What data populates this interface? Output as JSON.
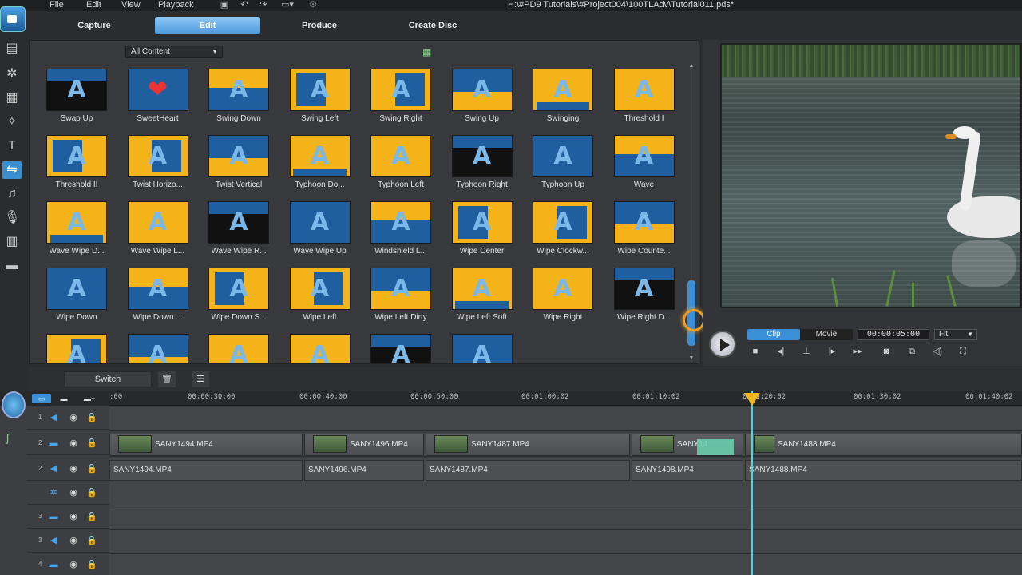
{
  "menu": [
    "File",
    "Edit",
    "View",
    "Playback"
  ],
  "file_path": "H:\\#PD9 Tutorials\\#Project004\\100TLAdv\\Tutorial011.pds*",
  "modes": [
    {
      "label": "Capture",
      "active": false
    },
    {
      "label": "Edit",
      "active": true
    },
    {
      "label": "Produce",
      "active": false
    },
    {
      "label": "Create Disc",
      "active": false
    }
  ],
  "library": {
    "filter_value": "All Content",
    "transitions": [
      [
        "Swap Up",
        "SweetHeart",
        "Swing Down",
        "Swing Left",
        "Swing Right",
        "Swing Up",
        "Swinging",
        "Threshold I"
      ],
      [
        "Threshold II",
        "Twist Horizo...",
        "Twist Vertical",
        "Typhoon Do...",
        "Typhoon Left",
        "Typhoon Right",
        "Typhoon Up",
        "Wave"
      ],
      [
        "Wave Wipe D...",
        "Wave Wipe L...",
        "Wave Wipe R...",
        "Wave Wipe Up",
        "Windshield L...",
        "Wipe Center",
        "Wipe Clockw...",
        "Wipe Counte..."
      ],
      [
        "Wipe Down",
        "Wipe Down ...",
        "Wipe Down S...",
        "Wipe Left",
        "Wipe Left Dirty",
        "Wipe Left Soft",
        "Wipe Right",
        "Wipe Right D..."
      ],
      [
        "",
        "",
        "",
        "",
        "",
        ""
      ]
    ]
  },
  "preview": {
    "mode_clip": "Clip",
    "mode_movie": "Movie",
    "timecode": "00:00:05:00",
    "fit": "Fit"
  },
  "timeline": {
    "switch_label": "Switch",
    "ruler": [
      ":00",
      "00;00;30;00",
      "00;00;40;00",
      "00;00;50;00",
      "00;01;00;02",
      "00;01;10;02",
      "0;01;20;02",
      "00;01;30;02",
      "00;01;40;02"
    ],
    "track_numbers": [
      "1",
      "2",
      "2",
      "",
      "3",
      "3",
      "4"
    ],
    "video_clips": [
      "SANY1494.MP4",
      "SANY1496.MP4",
      "SANY1487.MP4",
      "SANY14",
      "SANY1488.MP4"
    ],
    "audio_clips": [
      "SANY1494.MP4",
      "SANY1496.MP4",
      "SANY1487.MP4",
      "SANY1498.MP4",
      "SANY1488.MP4"
    ]
  },
  "colors": {
    "accent": "#3b8fd6",
    "transition_blue": "#1f5fa0",
    "transition_yellow": "#f3b319",
    "playhead": "#4ad7e0"
  }
}
